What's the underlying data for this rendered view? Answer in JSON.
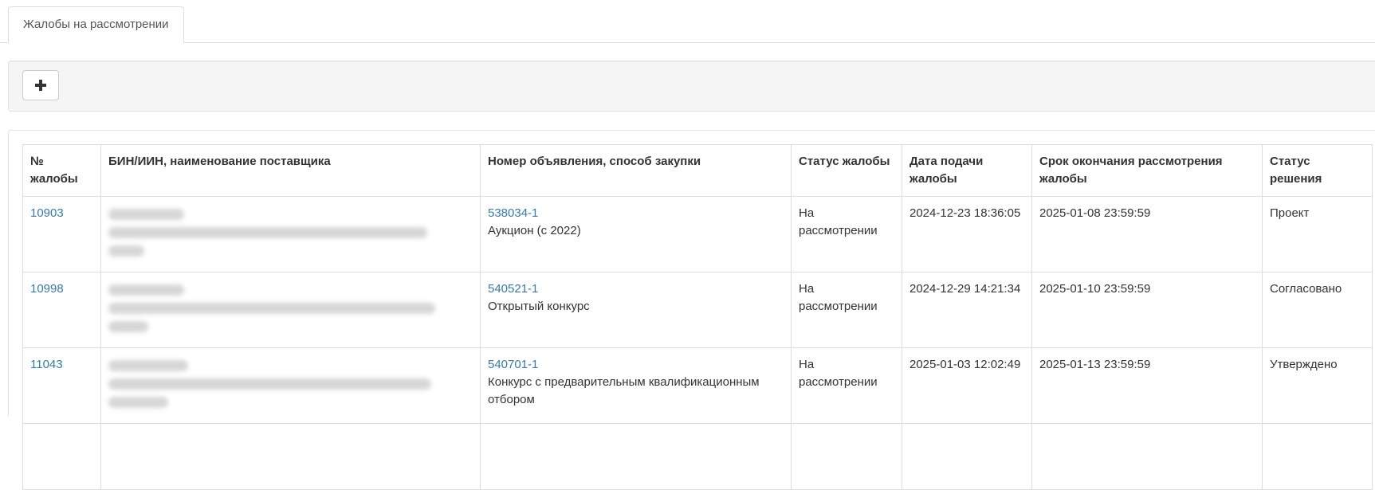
{
  "tabs": [
    {
      "label": "Жалобы на рассмотрении",
      "active": true
    }
  ],
  "toolbar": {
    "add_icon": "plus-icon"
  },
  "table": {
    "headers": [
      "№ жалобы",
      "БИН/ИИН, наименование поставщика",
      "Номер объявления, способ закупки",
      "Статус жалобы",
      "Дата подачи жалобы",
      "Срок окончания рассмотрения жалобы",
      "Статус решения"
    ],
    "rows": [
      {
        "id": "10903",
        "supplier": "",
        "announcement": "538034-1",
        "method": "Аукцион (с 2022)",
        "status": "На рассмотрении",
        "submitted": "2024-12-23 18:36:05",
        "deadline": "2025-01-08 23:59:59",
        "decision": "Проект"
      },
      {
        "id": "10998",
        "supplier": "",
        "announcement": "540521-1",
        "method": "Открытый конкурс",
        "status": "На рассмотрении",
        "submitted": "2024-12-29 14:21:34",
        "deadline": "2025-01-10 23:59:59",
        "decision": "Согласовано"
      },
      {
        "id": "11043",
        "supplier": "",
        "announcement": "540701-1",
        "method": "Конкурс с предварительным квалификационным отбором",
        "status": "На рассмотрении",
        "submitted": "2025-01-03 12:02:49",
        "deadline": "2025-01-13 23:59:59",
        "decision": "Утверждено"
      },
      {
        "id": "",
        "supplier": "",
        "announcement": "",
        "method": "",
        "status": "",
        "submitted": "",
        "deadline": "",
        "decision": ""
      }
    ]
  },
  "colors": {
    "link": "#337ab7",
    "border": "#dddddd",
    "toolbar_bg": "#f5f5f5"
  }
}
